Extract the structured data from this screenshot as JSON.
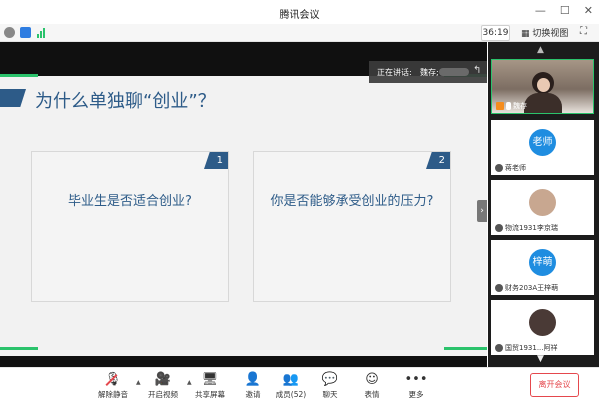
{
  "app": {
    "title": "腾讯会议"
  },
  "status": {
    "timer": "36:19",
    "switch_view": "切换视图"
  },
  "slide": {
    "title": "为什么单独聊“创业”？",
    "cards": [
      {
        "number": "1",
        "text": "毕业生是否适合创业?"
      },
      {
        "number": "2",
        "text": "你是否能够承受创业的压力?"
      }
    ]
  },
  "speaking": {
    "label": "正在讲话:",
    "name": "魏存;"
  },
  "participants": [
    {
      "name": "魏存",
      "type": "video"
    },
    {
      "name": "蒋老师",
      "avatar_text": "老师",
      "type": "circle"
    },
    {
      "name": "物流1931李京瑞",
      "type": "photo"
    },
    {
      "name": "财务203A王梓萌",
      "avatar_text": "梓萌",
      "type": "circle"
    },
    {
      "name": "国贸1931...阿祥",
      "type": "photo"
    }
  ],
  "toolbar": {
    "unmute": "解除静音",
    "start_video": "开启视频",
    "share_screen": "共享屏幕",
    "invite": "邀请",
    "members": "成员(52)",
    "chat": "聊天",
    "reactions": "表情",
    "more": "更多",
    "leave": "离开会议"
  },
  "colors": {
    "accent_blue": "#2d5b88",
    "active_green": "#2bc36c",
    "leave_red": "#e5484d"
  }
}
